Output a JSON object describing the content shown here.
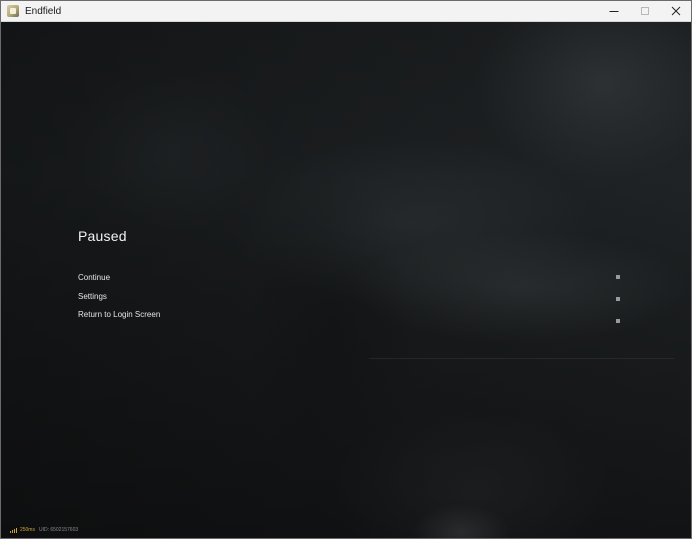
{
  "window": {
    "title": "Endfield",
    "controls": {
      "minimize_icon": "minimize-icon",
      "maximize_icon": "maximize-icon",
      "close_icon": "close-icon"
    }
  },
  "pause_menu": {
    "title": "Paused",
    "items": [
      {
        "label": "Continue"
      },
      {
        "label": "Settings"
      },
      {
        "label": "Return to Login Screen"
      }
    ]
  },
  "status_bar": {
    "signal_icon": "signal-strength-icon",
    "latency": "250ms",
    "uid": "UID: 6502157603"
  },
  "colors": {
    "signal_accent": "#c8a63a",
    "menu_text": "#e6e6e6",
    "title_bar_bg": "#f3f3f3"
  }
}
